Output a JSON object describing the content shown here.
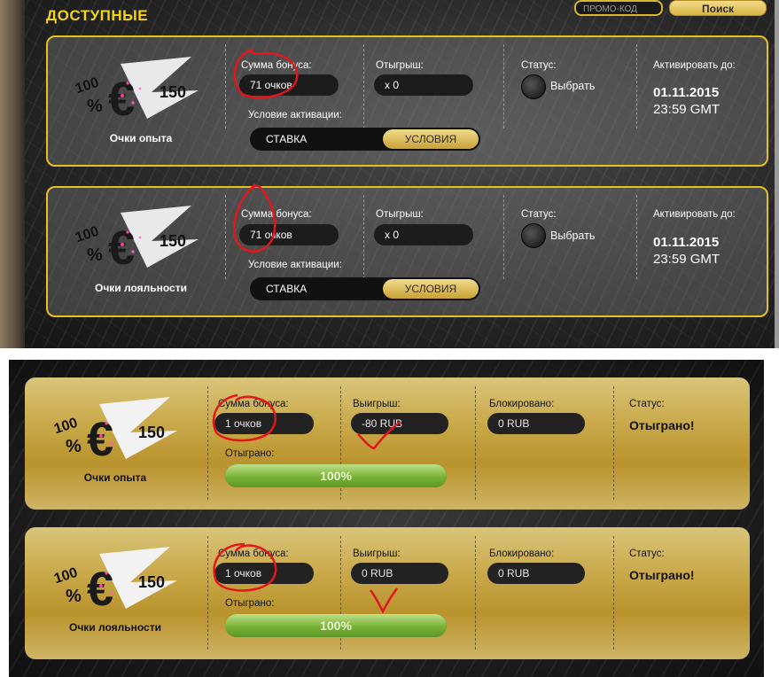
{
  "top": {
    "section_title": "ДОСТУПНЫЕ",
    "promo_placeholder": "ПРОМО-КОД",
    "search_label": "Поиск",
    "cards": [
      {
        "logo_text": "100 % € 150",
        "caption": "Очки опыта",
        "bonus_label": "Сумма бонуса:",
        "bonus_value": "71 очков",
        "wager_label": "Отыгрыш:",
        "wager_value": "x 0",
        "status_label": "Статус:",
        "status_option": "Выбрать",
        "activate_label": "Активировать до:",
        "activate_date": "01.11.2015",
        "activate_time": "23:59 GMT",
        "condition_label": "Условие активации:",
        "condition_value": "СТАВКА",
        "condition_button": "УСЛОВИЯ"
      },
      {
        "logo_text": "100 % € 150",
        "caption": "Очки лояльности",
        "bonus_label": "Сумма бонуса:",
        "bonus_value": "71 очков",
        "wager_label": "Отыгрыш:",
        "wager_value": "x 0",
        "status_label": "Статус:",
        "status_option": "Выбрать",
        "activate_label": "Активировать до:",
        "activate_date": "01.11.2015",
        "activate_time": "23:59 GMT",
        "condition_label": "Условие активации:",
        "condition_value": "СТАВКА",
        "condition_button": "УСЛОВИЯ"
      }
    ]
  },
  "bottom": {
    "cards": [
      {
        "logo_text": "100 % € 150",
        "caption": "Очки опыта",
        "bonus_label": "Сумма бонуса:",
        "bonus_value": "1 очков",
        "win_label": "Выигрыш:",
        "win_value": "-80 RUB",
        "blocked_label": "Блокировано:",
        "blocked_value": "0 RUB",
        "status_label": "Статус:",
        "status_value": "Отыграно!",
        "played_label": "Отыграно:",
        "played_percent": 100,
        "played_text": "100%"
      },
      {
        "logo_text": "100 % € 150",
        "caption": "Очки лояльности",
        "bonus_label": "Сумма бонуса:",
        "bonus_value": "1 очков",
        "win_label": "Выигрыш:",
        "win_value": "0 RUB",
        "blocked_label": "Блокировано:",
        "blocked_value": "0 RUB",
        "status_label": "Статус:",
        "status_value": "Отыграно!",
        "played_label": "Отыграно:",
        "played_percent": 100,
        "played_text": "100%"
      }
    ]
  },
  "colors": {
    "accent_yellow": "#e6c01d",
    "annotation_red": "#e3161b",
    "progress_green": "#78b236"
  }
}
